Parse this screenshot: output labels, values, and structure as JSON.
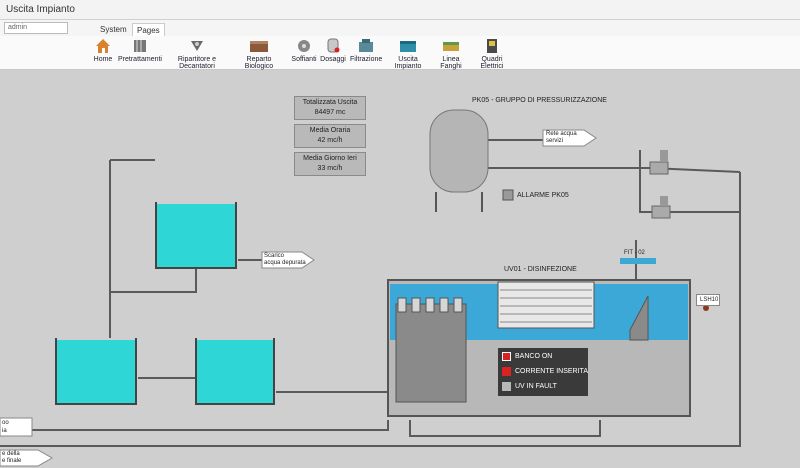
{
  "window": {
    "title": "Uscita Impianto"
  },
  "topbar": {
    "user_field": "admin",
    "tabs": [
      {
        "label": "System"
      },
      {
        "label": "Pages"
      }
    ]
  },
  "ribbon": {
    "buttons": [
      {
        "label": "Home"
      },
      {
        "label": "Pretrattamenti"
      },
      {
        "label": "Ripartitore e Decantatori"
      },
      {
        "label": "Reparto Biologico"
      },
      {
        "label": "Soffianti"
      },
      {
        "label": "Dosaggi"
      },
      {
        "label": "Filtrazione"
      },
      {
        "label": "Uscita Impianto"
      },
      {
        "label": "Linea Fanghi"
      },
      {
        "label": "Quadri Elettrici"
      }
    ]
  },
  "totals": {
    "totalizzata": {
      "label": "Totalizzata Uscita",
      "value": "84497 mc"
    },
    "media_oraria": {
      "label": "Media Oraria",
      "value": "42 mc/h"
    },
    "media_giorno": {
      "label": "Media Giorno Ieri",
      "value": "33 mc/h"
    }
  },
  "pressurization": {
    "title": "PK05 - GRUPPO DI PRESSURIZZAZIONE",
    "rete_line1": "Rete acqua",
    "rete_line2": "servizi",
    "alarm_label": "ALLARME PK05"
  },
  "outlet": {
    "scarico_line1": "Scarico",
    "scarico_line2": "acqua depurata",
    "left_tag1": "oo",
    "left_tag2": "ia"
  },
  "uv": {
    "title": "UV01 - DISINFEZIONE",
    "fit_tag": "FIT - 02",
    "ls_tag": "LSH10",
    "status": [
      {
        "label": "BANCO ON",
        "color": "#d92222"
      },
      {
        "label": "CORRENTE INSERITA",
        "color": "#d92222"
      },
      {
        "label": "UV IN FAULT",
        "color": "#b8b8b8"
      }
    ]
  },
  "footer": {
    "left_line1": "e della",
    "left_line2": "e finale"
  },
  "colors": {
    "water": "#2fd6d6",
    "background": "#cfcfcf",
    "pipe": "#5a5a5a",
    "uv_water": "#3ca8d8"
  }
}
